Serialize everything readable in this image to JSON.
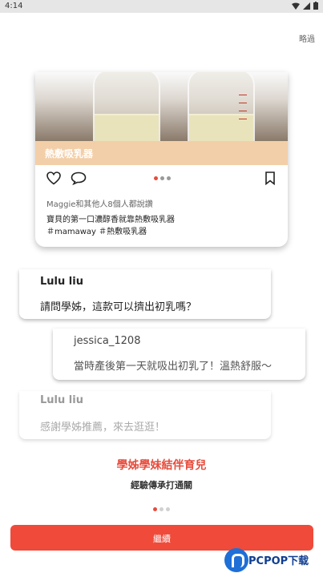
{
  "status_bar": {
    "time": "4:14"
  },
  "skip_label": "略過",
  "post": {
    "banner_title": "熱敷吸乳器",
    "likes_text": "Maggie和其他人8個人都說讚",
    "caption_line1": "寶貝的第一口濃醇香就靠熱敷吸乳器",
    "caption_line2": "＃mamaway ＃熱敷吸乳器"
  },
  "comments": [
    {
      "name": "Lulu liu",
      "text": "請問學姊，這款可以擠出初乳嗎？"
    },
    {
      "name": "jessica_1208",
      "text": "當時產後第一天就吸出初乳了！溫熱舒服～"
    },
    {
      "name": "Lulu liu",
      "text": "感謝學姊推薦，來去逛逛！"
    }
  ],
  "headline": "學姊學妹結伴育兒",
  "subheadline": "經驗傳承打通關",
  "pager": {
    "current": 1,
    "total": 3
  },
  "continue_label": "繼續",
  "watermark": {
    "text": "PCPOP下载"
  },
  "colors": {
    "accent": "#ef4a3a",
    "banner": "#f3cfa9"
  }
}
